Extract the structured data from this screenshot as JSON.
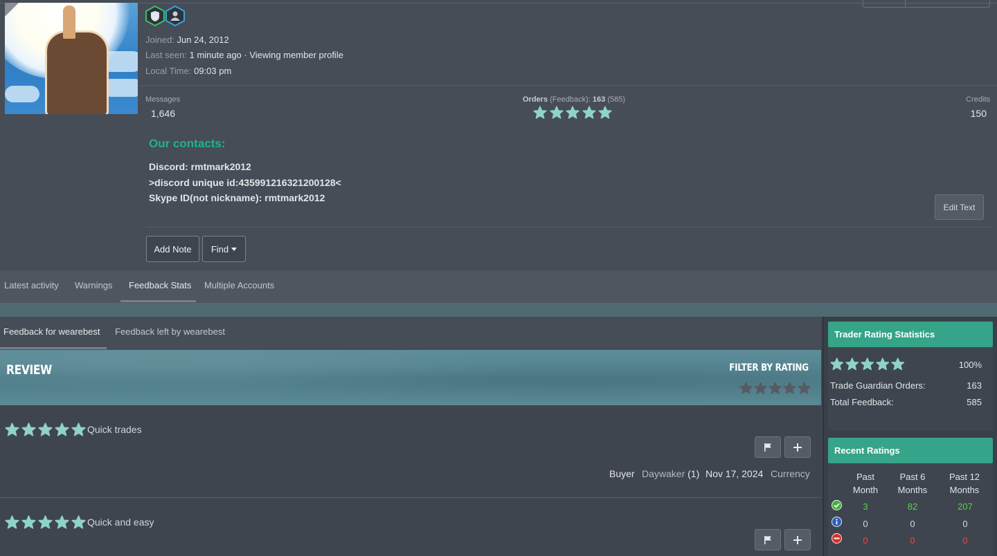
{
  "profile": {
    "joined_label": "Joined:",
    "joined_value": "Jun 24, 2012",
    "last_seen_label": "Last seen:",
    "last_seen_value": "1 minute ago · Viewing member profile",
    "local_time_label": "Local Time:",
    "local_time_value": "09:03 pm"
  },
  "stats": {
    "messages_label": "Messages",
    "messages_value": "1,646",
    "orders_label": "Orders",
    "orders_feedback_word": "(Feedback):",
    "orders_count": "163",
    "orders_feedback_count": "(585)",
    "orders_rating_stars": 5,
    "credits_label": "Credits",
    "credits_value": "150"
  },
  "contacts": {
    "title": "Our contacts:",
    "line1": "Discord: rmtmark2012",
    "line2": ">discord unique id:435991216321200128<",
    "line3": "Skype ID(not nickname): rmtmark2012"
  },
  "buttons": {
    "edit_text": "Edit Text",
    "add_note": "Add Note",
    "find": "Find"
  },
  "tabs": [
    "Latest activity",
    "Warnings",
    "Feedback Stats",
    "Multiple Accounts"
  ],
  "subtabs": [
    "Feedback for wearebest",
    "Feedback left by wearebest"
  ],
  "review_banner": {
    "title": "REVIEW",
    "filter_title": "FILTER BY RATING"
  },
  "reviews": [
    {
      "stars": 5,
      "text": "Quick trades",
      "role": "Buyer",
      "user": "Daywaker",
      "user_count": "(1)",
      "date": "Nov 17, 2024",
      "category": "Currency"
    },
    {
      "stars": 5,
      "text": "Quick and easy"
    }
  ],
  "sidebar": {
    "trader_title": "Trader Rating Statistics",
    "trader_percent": "100%",
    "trader_stars": 5,
    "tg_orders_label": "Trade Guardian Orders:",
    "tg_orders_value": "163",
    "total_feedback_label": "Total Feedback:",
    "total_feedback_value": "585",
    "recent_title": "Recent Ratings",
    "recent_cols": [
      "Past Month",
      "Past 6 Months",
      "Past 12 Months"
    ],
    "recent_rows": [
      {
        "type": "positive",
        "values": [
          "3",
          "82",
          "207"
        ]
      },
      {
        "type": "neutral",
        "values": [
          "0",
          "0",
          "0"
        ]
      },
      {
        "type": "negative",
        "values": [
          "0",
          "0",
          "0"
        ]
      }
    ]
  },
  "colors": {
    "accent": "#36a488",
    "contacts_title": "#1fb38d",
    "star": "#8fd3c4",
    "positive": "#55d149",
    "negative": "#e9473e"
  }
}
